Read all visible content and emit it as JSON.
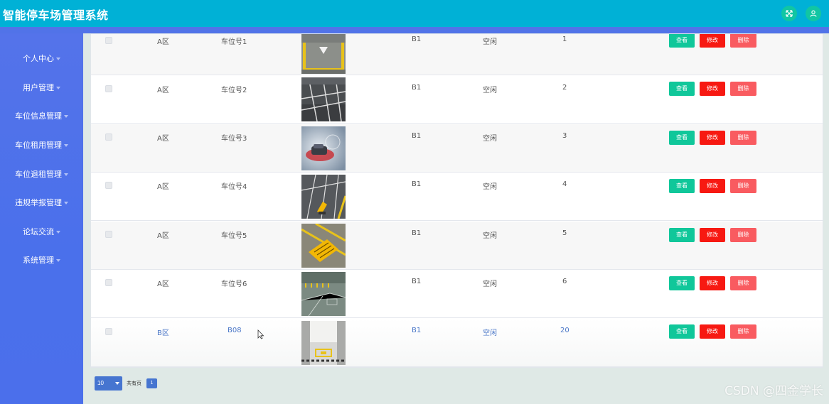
{
  "app": {
    "title": "智能停车场管理系统"
  },
  "topbar_icons": [
    "fullscreen-icon",
    "user-icon"
  ],
  "sidebar": {
    "items": [
      {
        "label": "个人中心"
      },
      {
        "label": "用户管理"
      },
      {
        "label": "车位信息管理"
      },
      {
        "label": "车位租用管理"
      },
      {
        "label": "车位退租管理"
      },
      {
        "label": "违规举报管理"
      },
      {
        "label": "论坛交流"
      },
      {
        "label": "系统管理"
      }
    ]
  },
  "actions": {
    "view": "查看",
    "edit": "修改",
    "delete": "删除"
  },
  "rows": [
    {
      "area": "A区",
      "spot": "车位号1",
      "floor": "B1",
      "status": "空闲",
      "num": "1",
      "image": "parking-spot-arrow"
    },
    {
      "area": "A区",
      "spot": "车位号2",
      "floor": "B1",
      "status": "空闲",
      "num": "2",
      "image": "parking-lot-lines"
    },
    {
      "area": "A区",
      "spot": "车位号3",
      "floor": "B1",
      "status": "空闲",
      "num": "3",
      "image": "car-on-red-marking"
    },
    {
      "area": "A区",
      "spot": "车位号4",
      "floor": "B1",
      "status": "空闲",
      "num": "4",
      "image": "parking-lock-yellow"
    },
    {
      "area": "A区",
      "spot": "车位号5",
      "floor": "B1",
      "status": "空闲",
      "num": "5",
      "image": "yellow-text-marking"
    },
    {
      "area": "A区",
      "spot": "车位号6",
      "floor": "B1",
      "status": "空闲",
      "num": "6",
      "image": "underground-garage"
    },
    {
      "area": "B区",
      "spot": "B08",
      "floor": "B1",
      "status": "空闲",
      "num": "20",
      "image": "garage-spot-b08"
    }
  ],
  "pagination": {
    "page_size": "10",
    "total_label": "共有页",
    "current_page": "1"
  },
  "watermark": "CSDN @四金学长",
  "colors": {
    "topbar": "#00b1d6",
    "sidebar": "#4b6feb",
    "view": "#10c79a",
    "edit": "#f71912",
    "delete": "#f95b60",
    "link": "#4c78c8"
  }
}
